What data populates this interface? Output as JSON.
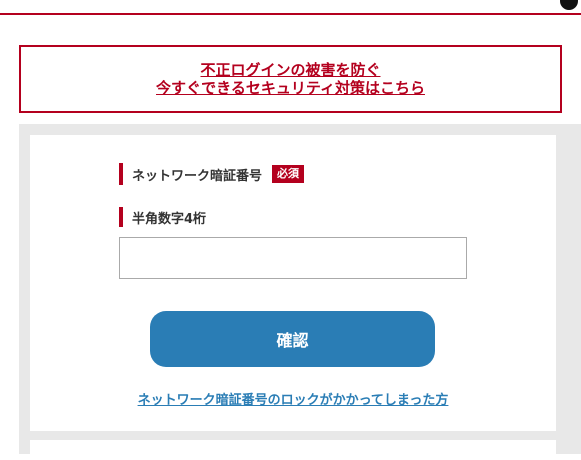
{
  "alert": {
    "line1": "不正ログインの被害を防ぐ",
    "line2": "今すぐできるセキュリティ対策はこちら"
  },
  "form": {
    "field_label": "ネットワーク暗証番号",
    "required_badge": "必須",
    "hint_label": "半角数字4桁",
    "pin_value": "",
    "pin_placeholder": "",
    "confirm_label": "確認",
    "locked_link": "ネットワーク暗証番号のロックがかかってしまった方"
  },
  "colors": {
    "accent_red": "#b4001e",
    "button_blue": "#2a7db5",
    "panel_gray": "#e8e8e8"
  },
  "icons": {
    "corner": "account-icon"
  }
}
